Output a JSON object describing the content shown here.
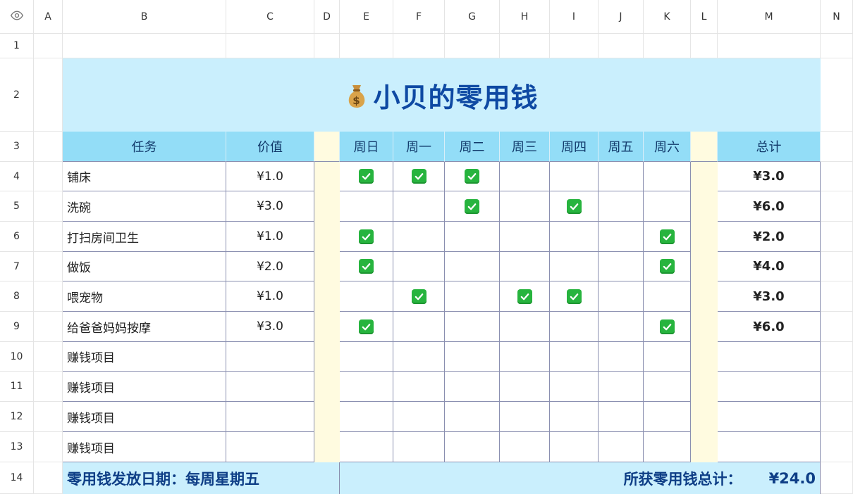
{
  "columns": [
    "A",
    "B",
    "C",
    "D",
    "E",
    "F",
    "G",
    "H",
    "I",
    "J",
    "K",
    "L",
    "M",
    "N"
  ],
  "rows": [
    "1",
    "2",
    "3",
    "4",
    "5",
    "6",
    "7",
    "8",
    "9",
    "10",
    "11",
    "12",
    "13",
    "14"
  ],
  "title": "小贝的零用钱",
  "title_icon": "money-bag-icon",
  "headers": {
    "task": "任务",
    "value": "价值",
    "days": [
      "周日",
      "周一",
      "周二",
      "周三",
      "周四",
      "周五",
      "周六"
    ],
    "total": "总计"
  },
  "tasks": [
    {
      "name": "铺床",
      "value": "¥1.0",
      "checks": [
        true,
        true,
        true,
        false,
        false,
        false,
        false
      ],
      "total": "¥3.0"
    },
    {
      "name": "洗碗",
      "value": "¥3.0",
      "checks": [
        false,
        false,
        true,
        false,
        true,
        false,
        false
      ],
      "total": "¥6.0"
    },
    {
      "name": "打扫房间卫生",
      "value": "¥1.0",
      "checks": [
        true,
        false,
        false,
        false,
        false,
        false,
        true
      ],
      "total": "¥2.0"
    },
    {
      "name": "做饭",
      "value": "¥2.0",
      "checks": [
        true,
        false,
        false,
        false,
        false,
        false,
        true
      ],
      "total": "¥4.0"
    },
    {
      "name": "喂宠物",
      "value": "¥1.0",
      "checks": [
        false,
        true,
        false,
        true,
        true,
        false,
        false
      ],
      "total": "¥3.0"
    },
    {
      "name": "给爸爸妈妈按摩",
      "value": "¥3.0",
      "checks": [
        true,
        false,
        false,
        false,
        false,
        false,
        true
      ],
      "total": "¥6.0"
    },
    {
      "name": "赚钱项目",
      "value": "",
      "checks": [
        false,
        false,
        false,
        false,
        false,
        false,
        false
      ],
      "total": ""
    },
    {
      "name": "赚钱项目",
      "value": "",
      "checks": [
        false,
        false,
        false,
        false,
        false,
        false,
        false
      ],
      "total": ""
    },
    {
      "name": "赚钱项目",
      "value": "",
      "checks": [
        false,
        false,
        false,
        false,
        false,
        false,
        false
      ],
      "total": ""
    },
    {
      "name": "赚钱项目",
      "value": "",
      "checks": [
        false,
        false,
        false,
        false,
        false,
        false,
        false
      ],
      "total": ""
    }
  ],
  "footer": {
    "pay_date": "零用钱发放日期：每周星期五",
    "grand_total_label": "所获零用钱总计：",
    "grand_total": "¥24.0"
  },
  "colors": {
    "title_bg": "#caeffd",
    "header_bg": "#93ddf7",
    "separator_bg": "#fffbe0",
    "title_text": "#0e49a3",
    "check_green": "#27b43e"
  }
}
